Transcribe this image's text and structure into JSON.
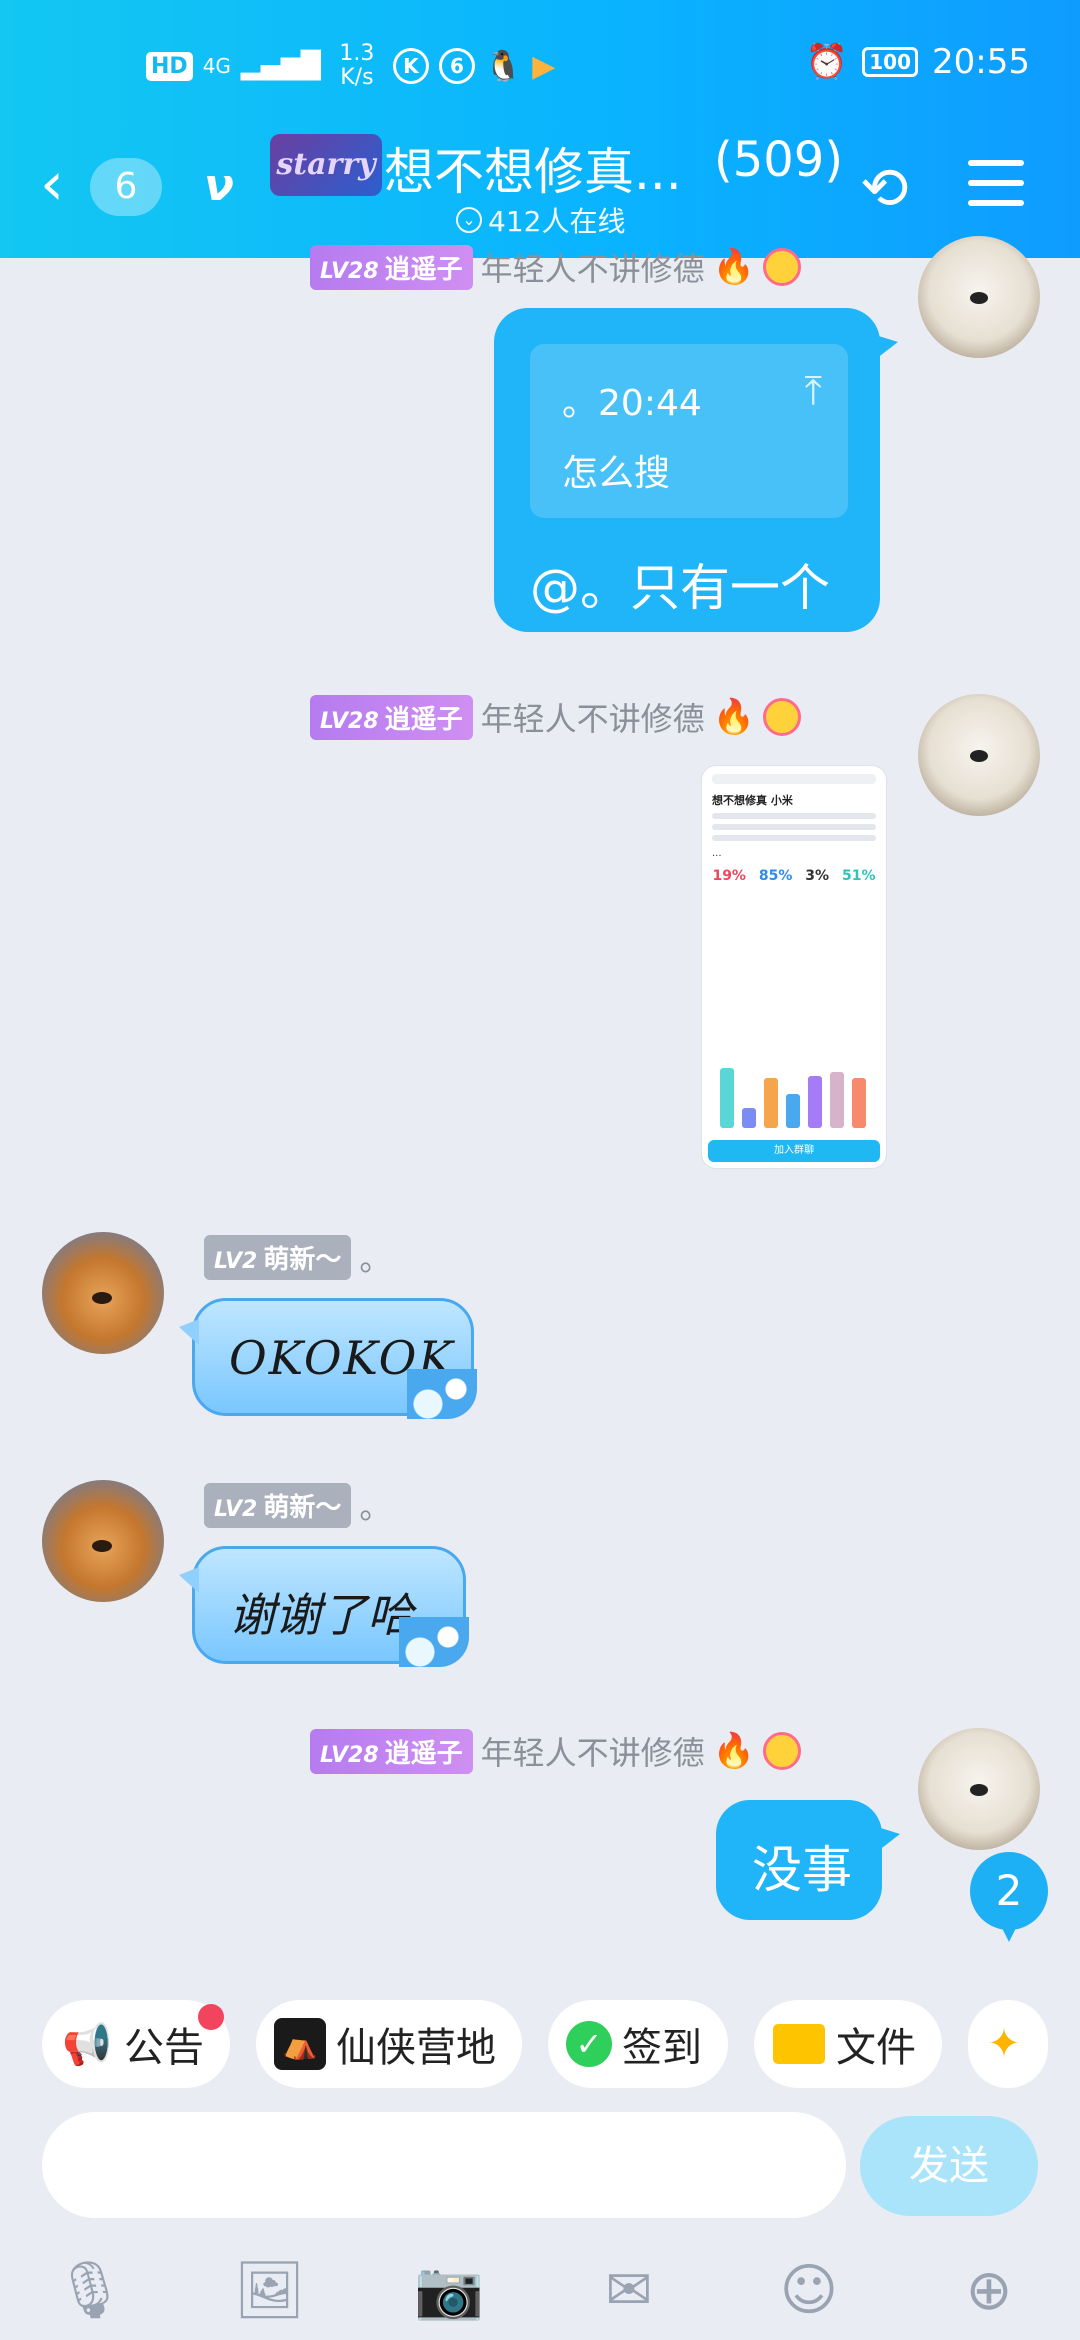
{
  "status_bar": {
    "hd": "HD",
    "network": "4G",
    "speed": "1.3\nK/s",
    "time": "20:55",
    "battery": "100",
    "icons": [
      "signal-icon",
      "k-app-icon",
      "weibo-icon",
      "qq-penguin-icon",
      "play-app-icon",
      "alarm-icon"
    ]
  },
  "header": {
    "back_count": "6",
    "logo_text": "starry",
    "title": "想不想修真...",
    "member_count": "(509)",
    "online_text": "412人在线"
  },
  "messages": [
    {
      "type": "partial_name_row",
      "level": "LV28",
      "nickname": "逍遥子",
      "tag": "年轻人不讲修德"
    },
    {
      "type": "reply",
      "side": "right",
      "quote_name": "。20:44",
      "quote_text": "怎么搜",
      "text": "@。只有一个"
    },
    {
      "type": "image",
      "side": "right",
      "level": "LV28",
      "nickname": "逍遥子",
      "tag": "年轻人不讲修德",
      "image": {
        "title": "想不想修真 小米",
        "stats": [
          "19%",
          "85%",
          "3%",
          "51%"
        ],
        "join": "加入群聊"
      }
    },
    {
      "type": "text",
      "side": "left",
      "level": "LV2",
      "nickname": "萌新～",
      "tag": "。",
      "text": "OKOKOK"
    },
    {
      "type": "text",
      "side": "left",
      "level": "LV2",
      "nickname": "萌新～",
      "tag": "。",
      "text": "谢谢了哈"
    },
    {
      "type": "text",
      "side": "right",
      "level": "LV28",
      "nickname": "逍遥子",
      "tag": "年轻人不讲修德",
      "text": "没事"
    }
  ],
  "unread_count": "2",
  "quick_bar": [
    {
      "label": "公告",
      "icon": "megaphone-icon",
      "has_dot": true
    },
    {
      "label": "仙侠营地",
      "icon": "camp-icon"
    },
    {
      "label": "签到",
      "icon": "checkin-icon"
    },
    {
      "label": "文件",
      "icon": "folder-icon"
    }
  ],
  "input": {
    "placeholder": "",
    "value": ""
  },
  "send_label": "发送",
  "toolbar": [
    "microphone-icon",
    "image-icon",
    "camera-icon",
    "red-packet-icon",
    "emoji-icon",
    "plus-icon"
  ],
  "colors": {
    "header": "#0ab2ff",
    "bubble": "#20b4f8",
    "background": "#e9ecf3",
    "level_badge": "#b57bf0"
  }
}
